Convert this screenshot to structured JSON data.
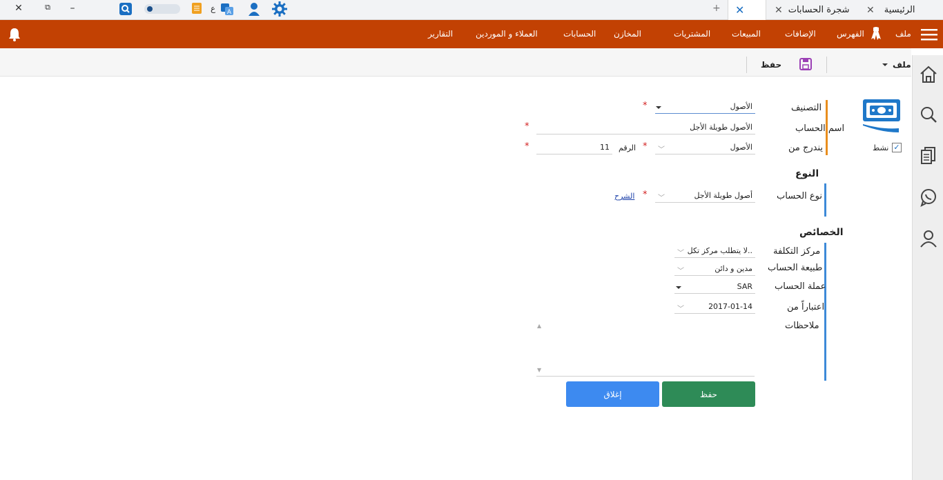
{
  "titlebar": {
    "tabs": [
      {
        "label": "الرئيسية"
      },
      {
        "label": "شجرة الحسابات"
      }
    ],
    "new_tab_symbol": "+",
    "lang_letter": "ع",
    "window_controls": {
      "minimize": "–",
      "restore": "⧉",
      "close": "✕"
    }
  },
  "menubar": {
    "items": [
      "ملف",
      "الفهرس",
      "الإضافات",
      "المبيعات",
      "المشتريات",
      "المخازن",
      "الحسابات",
      "العملاء و الموردين",
      "التقارير"
    ],
    "bell_icon": "bell-icon",
    "menu_icon": "hamburger-icon"
  },
  "toolbar": {
    "file_menu": "ملف",
    "save_label": "حفظ"
  },
  "form": {
    "active_label": "نشط",
    "active_checked": true,
    "classification_label": "التصنيف",
    "classification_value": "الأصول",
    "account_name_label": "اسم الحساب",
    "account_name_value": "الأصول طويلة الأجل",
    "parent_label": "يندرج من",
    "parent_value": "الأصول",
    "number_label": "الرقم",
    "number_value": "11",
    "type_section": "النوع",
    "account_type_label": "نوع الحساب",
    "account_type_value": "أصول طويلة الأجل",
    "explain_link": "الشرح",
    "properties_section": "الخصائص",
    "cost_center_label": "مركز التكلفة",
    "cost_center_value": "لا يتطلب مركز تكل..",
    "nature_label": "طبيعة الحساب",
    "nature_value": "مدين و دائن",
    "currency_label": "عملة الحساب",
    "currency_value": "SAR",
    "since_label": "اعتباراً من",
    "since_value": "2017-01-14",
    "notes_label": "ملاحظات",
    "required_mark": "*",
    "save_button": "حفظ",
    "close_button": "إغلاق"
  },
  "colors": {
    "menubar": "#c24103",
    "save_button": "#2e8b57",
    "close_button": "#3d8af0",
    "accent_orange": "#e98e1e",
    "accent_blue": "#3d8ad8"
  }
}
